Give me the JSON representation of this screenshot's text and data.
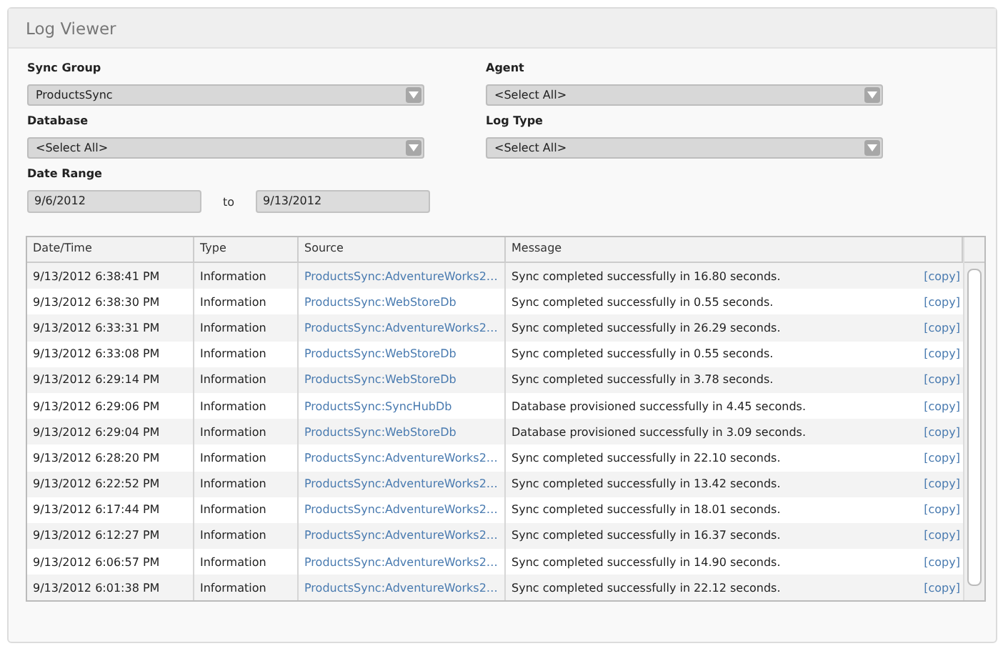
{
  "panel": {
    "title": "Log Viewer"
  },
  "filters": [
    {
      "label": "Sync Group",
      "value": "ProductsSync"
    },
    {
      "label": "Agent",
      "value": "<Select All>"
    },
    {
      "label": "Database",
      "value": "<Select All>"
    },
    {
      "label": "Log Type",
      "value": "<Select All>"
    }
  ],
  "date_range": {
    "label": "Date Range",
    "from": "9/6/2012",
    "separator": "to",
    "to": "9/13/2012"
  },
  "table": {
    "columns": [
      "Date/Time",
      "Type",
      "Source",
      "Message"
    ],
    "rows": [
      {
        "datetime": "9/13/2012 6:38:41 PM",
        "type": "Information",
        "source": "ProductsSync:AdventureWorks2…",
        "message": "Sync completed successfully in 16.80 seconds.",
        "action": "[copy]"
      },
      {
        "datetime": "9/13/2012 6:38:30 PM",
        "type": "Information",
        "source": "ProductsSync:WebStoreDb",
        "message": "Sync completed successfully in 0.55 seconds.",
        "action": "[copy]"
      },
      {
        "datetime": "9/13/2012 6:33:31 PM",
        "type": "Information",
        "source": "ProductsSync:AdventureWorks2…",
        "message": "Sync completed successfully in 26.29 seconds.",
        "action": "[copy]"
      },
      {
        "datetime": "9/13/2012 6:33:08 PM",
        "type": "Information",
        "source": "ProductsSync:WebStoreDb",
        "message": "Sync completed successfully in 0.55 seconds.",
        "action": "[copy]"
      },
      {
        "datetime": "9/13/2012 6:29:14 PM",
        "type": "Information",
        "source": "ProductsSync:WebStoreDb",
        "message": "Sync completed successfully in 3.78 seconds.",
        "action": "[copy]"
      },
      {
        "datetime": "9/13/2012 6:29:06 PM",
        "type": "Information",
        "source": "ProductsSync:SyncHubDb",
        "message": "Database provisioned successfully in 4.45 seconds.",
        "action": "[copy]"
      },
      {
        "datetime": "9/13/2012 6:29:04 PM",
        "type": "Information",
        "source": "ProductsSync:WebStoreDb",
        "message": "Database provisioned successfully in 3.09 seconds.",
        "action": "[copy]"
      },
      {
        "datetime": "9/13/2012 6:28:20 PM",
        "type": "Information",
        "source": "ProductsSync:AdventureWorks2…",
        "message": "Sync completed successfully in 22.10 seconds.",
        "action": "[copy]"
      },
      {
        "datetime": "9/13/2012 6:22:52 PM",
        "type": "Information",
        "source": "ProductsSync:AdventureWorks2…",
        "message": "Sync completed successfully in 13.42 seconds.",
        "action": "[copy]"
      },
      {
        "datetime": "9/13/2012 6:17:44 PM",
        "type": "Information",
        "source": "ProductsSync:AdventureWorks2…",
        "message": "Sync completed successfully in 18.01 seconds.",
        "action": "[copy]"
      },
      {
        "datetime": "9/13/2012 6:12:27 PM",
        "type": "Information",
        "source": "ProductsSync:AdventureWorks2…",
        "message": "Sync completed successfully in 16.37 seconds.",
        "action": "[copy]"
      },
      {
        "datetime": "9/13/2012 6:06:57 PM",
        "type": "Information",
        "source": "ProductsSync:AdventureWorks2…",
        "message": "Sync completed successfully in 14.90 seconds.",
        "action": "[copy]"
      },
      {
        "datetime": "9/13/2012 6:01:38 PM",
        "type": "Information",
        "source": "ProductsSync:AdventureWorks2…",
        "message": "Sync completed successfully in 22.12 seconds.",
        "action": "[copy]"
      }
    ]
  }
}
